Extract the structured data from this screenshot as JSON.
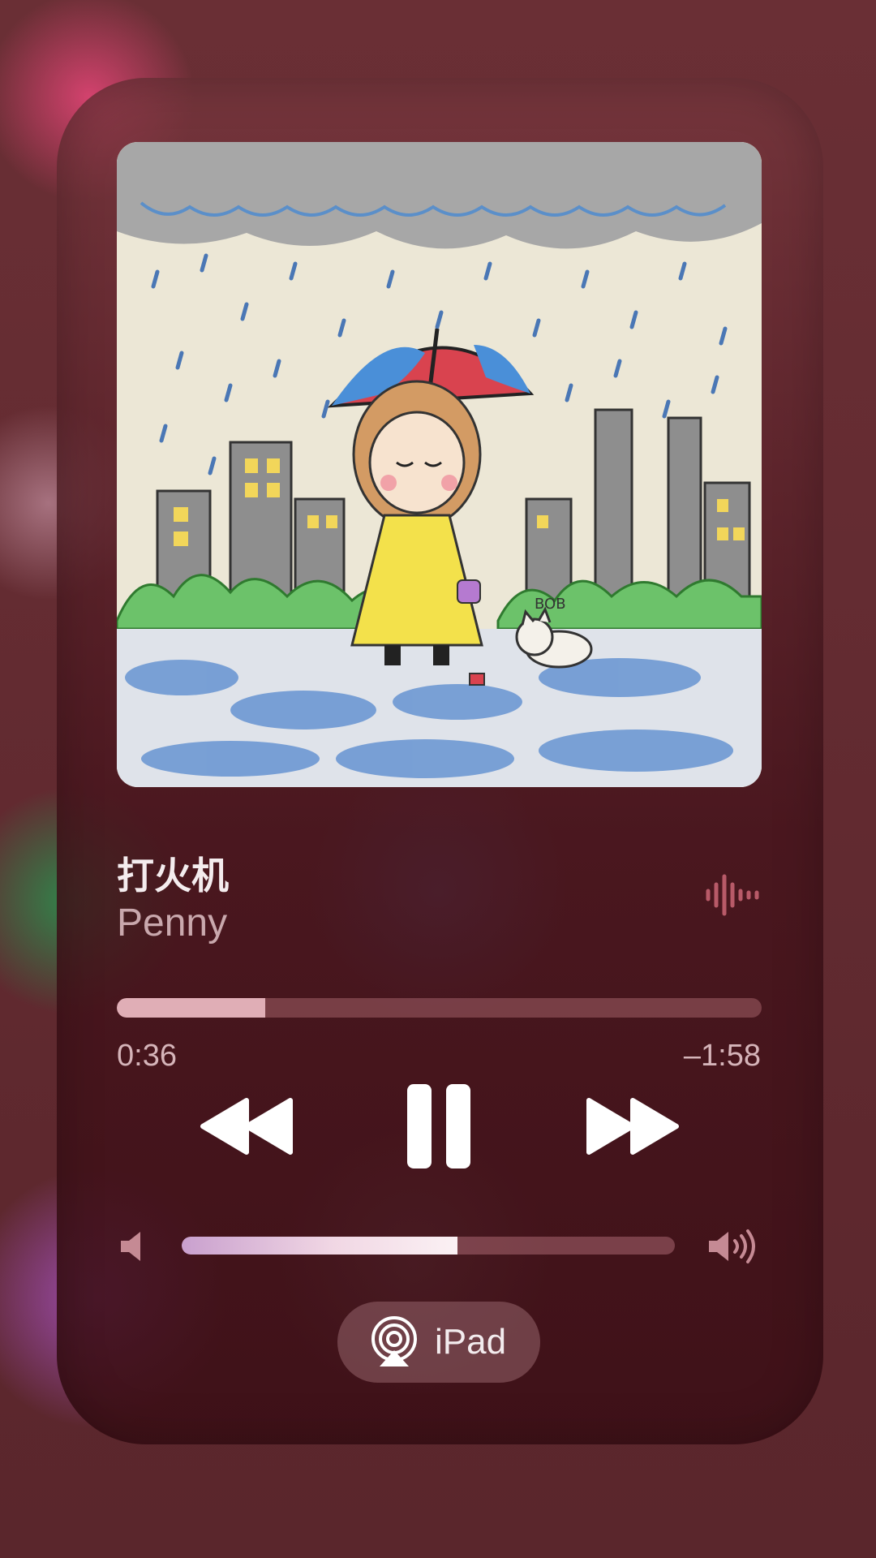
{
  "now_playing": {
    "title": "打火机",
    "artist": "Penny",
    "artwork_badge": "BOB",
    "progress": 0.23,
    "elapsed": "0:36",
    "remaining": "–1:58"
  },
  "controls": {
    "rewind_icon": "backward-icon",
    "pause_icon": "pause-icon",
    "forward_icon": "forward-icon",
    "waveform_icon": "audio-waveform-icon"
  },
  "volume": {
    "level": 0.56,
    "low_icon": "volume-low-icon",
    "high_icon": "volume-high-icon"
  },
  "airplay": {
    "label": "iPad",
    "icon": "airplay-icon"
  },
  "colors": {
    "background": "#5e2a30",
    "progress_fill": "#e0aeb6",
    "text_primary": "#f4ecee",
    "text_secondary": "#c9a8ad"
  }
}
